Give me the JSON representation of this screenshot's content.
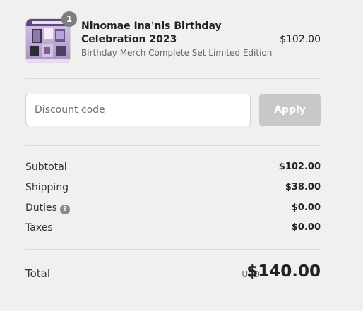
{
  "cart": {
    "item": {
      "quantity": "1",
      "name": "Ninomae Ina'nis Birthday Celebration 2023",
      "variant": "Birthday Merch Complete Set Limited Edition",
      "price": "$102.00",
      "image_icon": "product-thumbnail"
    }
  },
  "discount": {
    "placeholder": "Discount code",
    "apply_label": "Apply"
  },
  "summary": {
    "subtotal_label": "Subtotal",
    "subtotal_value": "$102.00",
    "shipping_label": "Shipping",
    "shipping_value": "$38.00",
    "duties_label": "Duties",
    "duties_help": "?",
    "duties_value": "$0.00",
    "taxes_label": "Taxes",
    "taxes_value": "$0.00"
  },
  "total": {
    "label": "Total",
    "currency": "USD",
    "value": "$140.00"
  },
  "colors": {
    "background": "#f0f0f0",
    "apply_disabled": "#c8c8c8",
    "badge": "#7d7d7d"
  }
}
